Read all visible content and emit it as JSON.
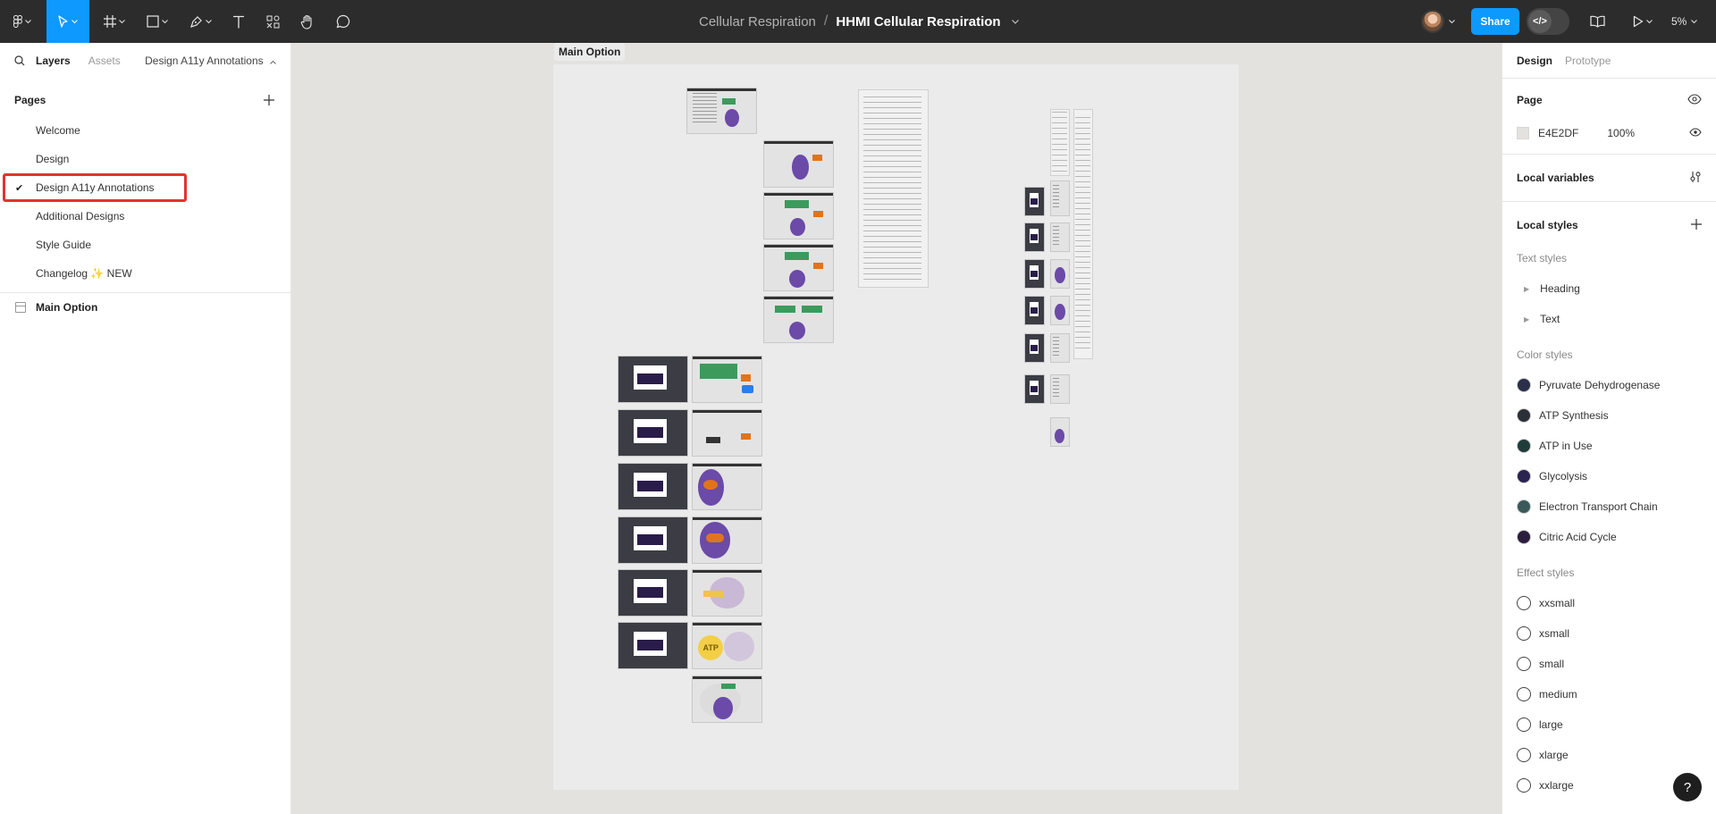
{
  "toolbar": {
    "tools": [
      "main-menu",
      "move",
      "frame",
      "shape",
      "pen",
      "text",
      "resources",
      "hand",
      "comment"
    ],
    "project": "Cellular Respiration",
    "separator": "/",
    "file": "HHMI Cellular Respiration",
    "share": "Share",
    "zoom": "5%"
  },
  "left": {
    "tab_layers": "Layers",
    "tab_assets": "Assets",
    "current_page": "Design A11y Annotations",
    "pages_label": "Pages",
    "pages": [
      "Welcome",
      "Design",
      "Design A11y Annotations",
      "Additional Designs",
      "Style Guide",
      "Changelog ✨ NEW"
    ],
    "selected_page": "Design A11y Annotations",
    "layers": [
      "Main Option"
    ]
  },
  "canvas": {
    "frame_name": "Main Option",
    "thumbnail_texts": [
      "ATP"
    ]
  },
  "right": {
    "tab_design": "Design",
    "tab_prototype": "Prototype",
    "page_label": "Page",
    "page_color": "E4E2DF",
    "page_opacity": "100%",
    "local_variables": "Local variables",
    "local_styles": "Local styles",
    "text_styles_label": "Text styles",
    "text_styles": [
      "Heading",
      "Text"
    ],
    "color_styles_label": "Color styles",
    "color_styles": [
      {
        "name": "Pyruvate Dehydrogenase",
        "color": "#2a2f4a"
      },
      {
        "name": "ATP Synthesis",
        "color": "#2b2f38"
      },
      {
        "name": "ATP in Use",
        "color": "#1f3b3a"
      },
      {
        "name": "Glycolysis",
        "color": "#2a2450"
      },
      {
        "name": "Electron Transport Chain",
        "color": "#3a5a5a"
      },
      {
        "name": "Citric Acid Cycle",
        "color": "#2c1d3c"
      }
    ],
    "effect_styles_label": "Effect styles",
    "effect_styles": [
      "xxsmall",
      "xsmall",
      "small",
      "medium",
      "large",
      "xlarge",
      "xxlarge"
    ],
    "help": "?"
  },
  "colors": {
    "topbar": "#2c2c2c",
    "accent": "#0d99ff",
    "canvas": "#e4e2df",
    "selection_outline": "#e5322e"
  }
}
